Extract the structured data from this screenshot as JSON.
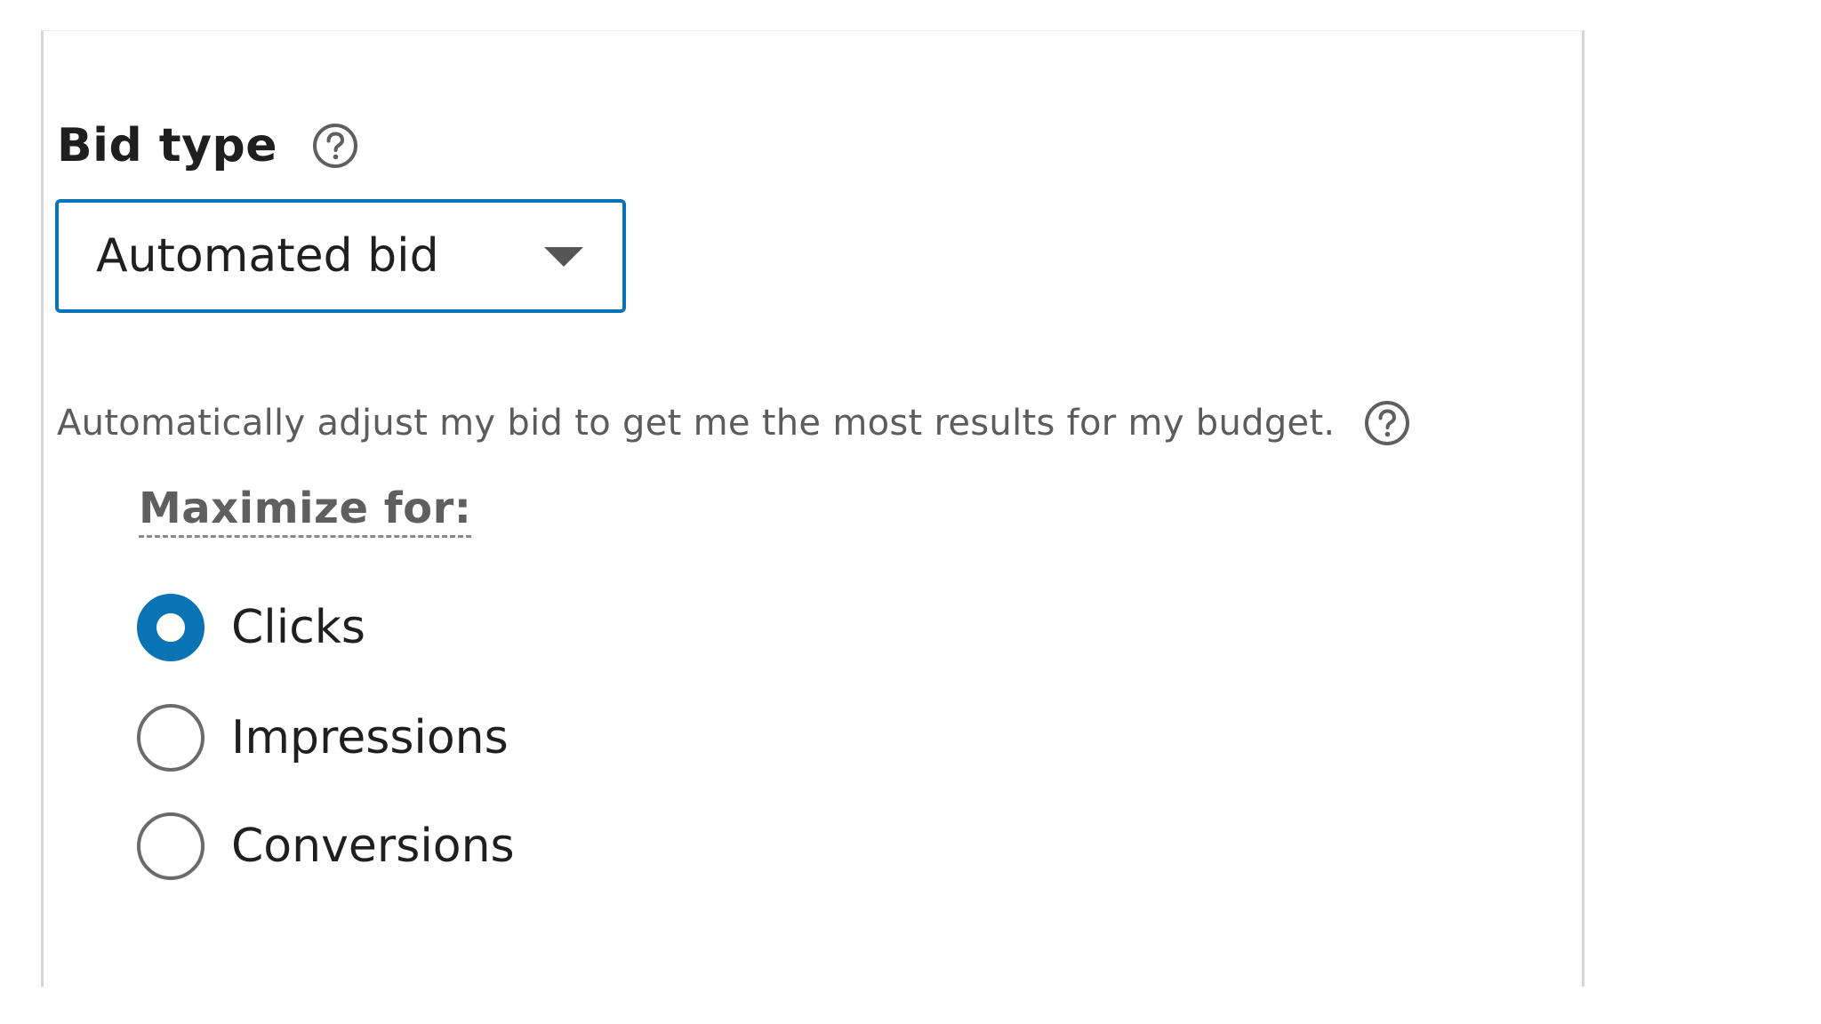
{
  "bid_type": {
    "heading": "Bid type",
    "help_icon": "question-circle-icon",
    "select": {
      "value": "Automated bid",
      "caret_icon": "caret-down-icon"
    },
    "description": "Automatically adjust my bid to get me the most results for my budget.",
    "description_help_icon": "question-circle-icon"
  },
  "maximize": {
    "label": "Maximize for:",
    "options": [
      {
        "label": "Clicks",
        "selected": true
      },
      {
        "label": "Impressions",
        "selected": false
      },
      {
        "label": "Conversions",
        "selected": false
      }
    ]
  },
  "colors": {
    "accent": "#0a73b4",
    "text": "#1f1f1f",
    "muted_text": "#5c5c5c"
  }
}
